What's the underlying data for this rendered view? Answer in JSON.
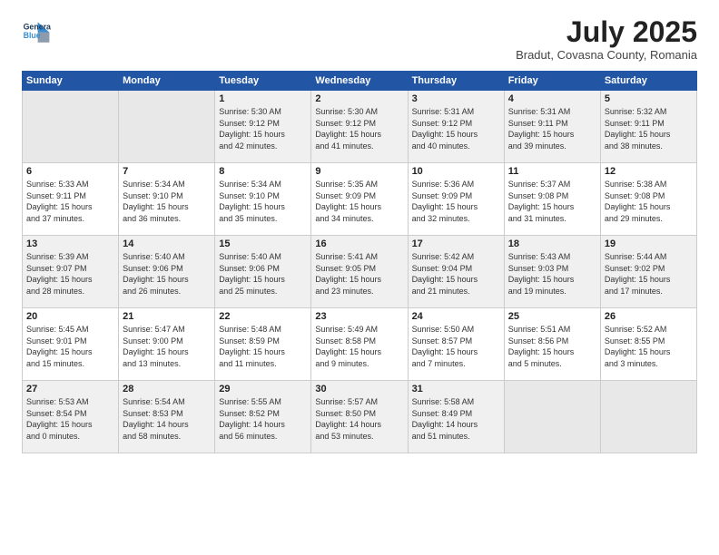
{
  "header": {
    "logo_line1": "General",
    "logo_line2": "Blue",
    "month": "July 2025",
    "location": "Bradut, Covasna County, Romania"
  },
  "days_of_week": [
    "Sunday",
    "Monday",
    "Tuesday",
    "Wednesday",
    "Thursday",
    "Friday",
    "Saturday"
  ],
  "weeks": [
    [
      {
        "day": "",
        "info": ""
      },
      {
        "day": "",
        "info": ""
      },
      {
        "day": "1",
        "info": "Sunrise: 5:30 AM\nSunset: 9:12 PM\nDaylight: 15 hours\nand 42 minutes."
      },
      {
        "day": "2",
        "info": "Sunrise: 5:30 AM\nSunset: 9:12 PM\nDaylight: 15 hours\nand 41 minutes."
      },
      {
        "day": "3",
        "info": "Sunrise: 5:31 AM\nSunset: 9:12 PM\nDaylight: 15 hours\nand 40 minutes."
      },
      {
        "day": "4",
        "info": "Sunrise: 5:31 AM\nSunset: 9:11 PM\nDaylight: 15 hours\nand 39 minutes."
      },
      {
        "day": "5",
        "info": "Sunrise: 5:32 AM\nSunset: 9:11 PM\nDaylight: 15 hours\nand 38 minutes."
      }
    ],
    [
      {
        "day": "6",
        "info": "Sunrise: 5:33 AM\nSunset: 9:11 PM\nDaylight: 15 hours\nand 37 minutes."
      },
      {
        "day": "7",
        "info": "Sunrise: 5:34 AM\nSunset: 9:10 PM\nDaylight: 15 hours\nand 36 minutes."
      },
      {
        "day": "8",
        "info": "Sunrise: 5:34 AM\nSunset: 9:10 PM\nDaylight: 15 hours\nand 35 minutes."
      },
      {
        "day": "9",
        "info": "Sunrise: 5:35 AM\nSunset: 9:09 PM\nDaylight: 15 hours\nand 34 minutes."
      },
      {
        "day": "10",
        "info": "Sunrise: 5:36 AM\nSunset: 9:09 PM\nDaylight: 15 hours\nand 32 minutes."
      },
      {
        "day": "11",
        "info": "Sunrise: 5:37 AM\nSunset: 9:08 PM\nDaylight: 15 hours\nand 31 minutes."
      },
      {
        "day": "12",
        "info": "Sunrise: 5:38 AM\nSunset: 9:08 PM\nDaylight: 15 hours\nand 29 minutes."
      }
    ],
    [
      {
        "day": "13",
        "info": "Sunrise: 5:39 AM\nSunset: 9:07 PM\nDaylight: 15 hours\nand 28 minutes."
      },
      {
        "day": "14",
        "info": "Sunrise: 5:40 AM\nSunset: 9:06 PM\nDaylight: 15 hours\nand 26 minutes."
      },
      {
        "day": "15",
        "info": "Sunrise: 5:40 AM\nSunset: 9:06 PM\nDaylight: 15 hours\nand 25 minutes."
      },
      {
        "day": "16",
        "info": "Sunrise: 5:41 AM\nSunset: 9:05 PM\nDaylight: 15 hours\nand 23 minutes."
      },
      {
        "day": "17",
        "info": "Sunrise: 5:42 AM\nSunset: 9:04 PM\nDaylight: 15 hours\nand 21 minutes."
      },
      {
        "day": "18",
        "info": "Sunrise: 5:43 AM\nSunset: 9:03 PM\nDaylight: 15 hours\nand 19 minutes."
      },
      {
        "day": "19",
        "info": "Sunrise: 5:44 AM\nSunset: 9:02 PM\nDaylight: 15 hours\nand 17 minutes."
      }
    ],
    [
      {
        "day": "20",
        "info": "Sunrise: 5:45 AM\nSunset: 9:01 PM\nDaylight: 15 hours\nand 15 minutes."
      },
      {
        "day": "21",
        "info": "Sunrise: 5:47 AM\nSunset: 9:00 PM\nDaylight: 15 hours\nand 13 minutes."
      },
      {
        "day": "22",
        "info": "Sunrise: 5:48 AM\nSunset: 8:59 PM\nDaylight: 15 hours\nand 11 minutes."
      },
      {
        "day": "23",
        "info": "Sunrise: 5:49 AM\nSunset: 8:58 PM\nDaylight: 15 hours\nand 9 minutes."
      },
      {
        "day": "24",
        "info": "Sunrise: 5:50 AM\nSunset: 8:57 PM\nDaylight: 15 hours\nand 7 minutes."
      },
      {
        "day": "25",
        "info": "Sunrise: 5:51 AM\nSunset: 8:56 PM\nDaylight: 15 hours\nand 5 minutes."
      },
      {
        "day": "26",
        "info": "Sunrise: 5:52 AM\nSunset: 8:55 PM\nDaylight: 15 hours\nand 3 minutes."
      }
    ],
    [
      {
        "day": "27",
        "info": "Sunrise: 5:53 AM\nSunset: 8:54 PM\nDaylight: 15 hours\nand 0 minutes."
      },
      {
        "day": "28",
        "info": "Sunrise: 5:54 AM\nSunset: 8:53 PM\nDaylight: 14 hours\nand 58 minutes."
      },
      {
        "day": "29",
        "info": "Sunrise: 5:55 AM\nSunset: 8:52 PM\nDaylight: 14 hours\nand 56 minutes."
      },
      {
        "day": "30",
        "info": "Sunrise: 5:57 AM\nSunset: 8:50 PM\nDaylight: 14 hours\nand 53 minutes."
      },
      {
        "day": "31",
        "info": "Sunrise: 5:58 AM\nSunset: 8:49 PM\nDaylight: 14 hours\nand 51 minutes."
      },
      {
        "day": "",
        "info": ""
      },
      {
        "day": "",
        "info": ""
      }
    ]
  ]
}
